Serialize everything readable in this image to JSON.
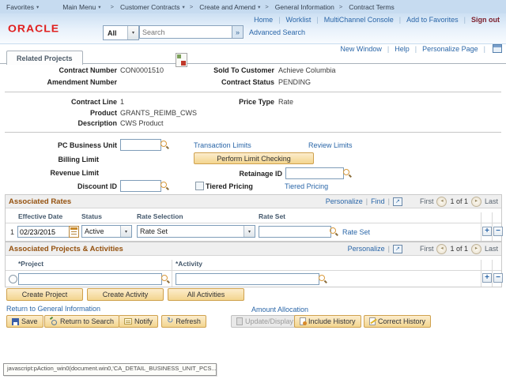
{
  "icons": {
    "dropdown_arrow": "▾",
    "breadcrumb_sep": ">",
    "pipe": "|",
    "search_go": "»",
    "nav_prev": "◂",
    "nav_next": "▸",
    "viewall_arrow": "↗",
    "plus": "+",
    "minus": "−",
    "refresh_glyph": "↻"
  },
  "colors": {
    "accent": "#cfa14e",
    "link": "#2a66a8",
    "section_title": "#95520f",
    "signout": "#7e222e",
    "breadcrumb_bg": "#c6dbf0"
  },
  "breadcrumb": {
    "favorites": "Favorites",
    "main_menu": "Main Menu",
    "trail": [
      "Customer Contracts",
      "Create and Amend",
      "General Information",
      "Contract Terms"
    ]
  },
  "header": {
    "logo_text": "ORACLE",
    "nav_links": [
      "Home",
      "Worklist",
      "MultiChannel Console",
      "Add to Favorites"
    ],
    "signout_label": "Sign out",
    "search_scope": "All",
    "search_placeholder": "Search",
    "advanced_search_label": "Advanced Search"
  },
  "pagebar": {
    "links": [
      "New Window",
      "Help",
      "Personalize Page"
    ]
  },
  "tabs": {
    "active": "Related Projects"
  },
  "general": {
    "fields": [
      {
        "label": "Contract Number",
        "value": "CON0001510"
      },
      {
        "label": "Sold To Customer",
        "value": "Achieve Columbia"
      },
      {
        "label": "Amendment Number",
        "value": ""
      },
      {
        "label": "Contract Status",
        "value": "PENDING"
      },
      {
        "label": "Contract Line",
        "value": "1"
      },
      {
        "label": "Price Type",
        "value": "Rate"
      },
      {
        "label": "Product",
        "value": "GRANTS_REIMB_CWS"
      },
      {
        "label": "Description",
        "value": "CWS Product"
      }
    ]
  },
  "limits": {
    "pc_business_unit_label": "PC Business Unit",
    "pc_business_unit_value": "",
    "transaction_limits_link": "Transaction Limits",
    "review_limits_link": "Review Limits",
    "billing_limit_label": "Billing Limit",
    "perform_limit_checking_button": "Perform Limit Checking",
    "revenue_limit_label": "Revenue Limit",
    "retainage_id_label": "Retainage ID",
    "retainage_id_value": "",
    "discount_id_label": "Discount ID",
    "discount_id_value": "",
    "tiered_pricing_checkbox_label": "Tiered Pricing",
    "tiered_pricing_checked": false,
    "tiered_pricing_link": "Tiered Pricing"
  },
  "rates": {
    "title": "Associated Rates",
    "personalize_link": "Personalize",
    "find_link": "Find",
    "pager": {
      "first": "First",
      "page": "1 of 1",
      "last": "Last"
    },
    "columns": [
      "Effective Date",
      "Status",
      "Rate Selection",
      "Rate Set"
    ],
    "rows": [
      {
        "num": "1",
        "effective_date": "02/23/2015",
        "status": "Active",
        "rate_selection": "Rate Set",
        "rate_set": "",
        "rate_set_link": "Rate Set"
      }
    ]
  },
  "projects": {
    "title": "Associated Projects & Activities",
    "personalize_link": "Personalize",
    "pager": {
      "first": "First",
      "page": "1 of 1",
      "last": "Last"
    },
    "columns": [
      "*Project",
      "*Activity"
    ],
    "rows": [
      {
        "project": "",
        "activity": ""
      }
    ],
    "action_buttons": [
      "Create Project",
      "Create Activity",
      "All Activities"
    ]
  },
  "footer": {
    "return_link": "Return to General Information",
    "amount_allocation_link": "Amount Allocation",
    "toolbar": {
      "save": "Save",
      "return_to_search": "Return to Search",
      "notify": "Notify",
      "refresh": "Refresh",
      "update_display": "Update/Display",
      "include_history": "Include History",
      "correct_history": "Correct History"
    }
  },
  "statusbar": {
    "message": "javascript:pAction_win0(document.win0,'CA_DETAIL_BUSINESS_UNIT_PCS..."
  }
}
